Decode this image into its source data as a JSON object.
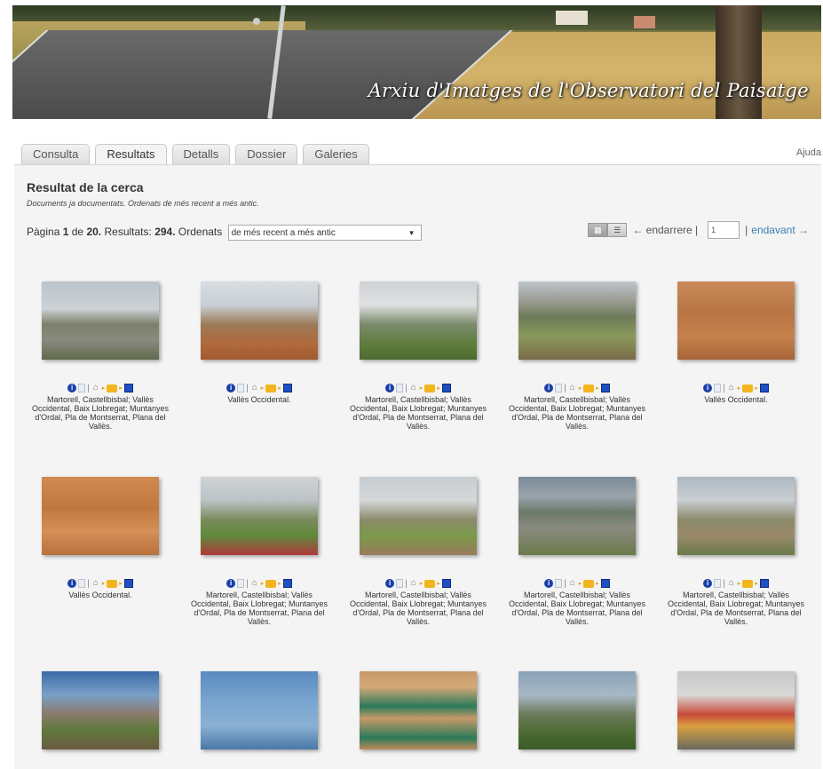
{
  "banner": {
    "title": "Arxiu d'Imatges de l'Observatori del Paisatge"
  },
  "tabs": [
    {
      "label": "Consulta",
      "active": false
    },
    {
      "label": "Resultats",
      "active": true
    },
    {
      "label": "Detalls",
      "active": false
    },
    {
      "label": "Dossier",
      "active": false
    },
    {
      "label": "Galeries",
      "active": false
    }
  ],
  "help_link": "Ajuda",
  "results": {
    "heading": "Resultat de la cerca",
    "subheading": "Documents ja documentats. Ordenats de més recent a més antic.",
    "page_label": "Pàgina",
    "page_current": "1",
    "page_of": "de",
    "page_total": "20.",
    "results_label": "Resultats:",
    "results_count": "294.",
    "sort_label": "Ordenats",
    "sort_value": "de més recent a més antic"
  },
  "pager": {
    "back_label": "← endarrere |",
    "page_value": "1",
    "separator": "|",
    "next_label": "endavant →"
  },
  "items": [
    {
      "caption": "Martorell, Castellbisbal; Vallès Occidental, Baix Llobregat; Muntanyes d'Ordal, Pla de Montserrat, Plana del Vallès."
    },
    {
      "caption": "Vallès Occidental."
    },
    {
      "caption": "Martorell, Castellbisbal; Vallès Occidental, Baix Llobregat; Muntanyes d'Ordal, Pla de Montserrat, Plana del Vallès."
    },
    {
      "caption": "Martorell, Castellbisbal; Vallès Occidental, Baix Llobregat; Muntanyes d'Ordal, Pla de Montserrat, Plana del Vallès."
    },
    {
      "caption": "Vallès Occidental."
    },
    {
      "caption": "Vallès Occidental."
    },
    {
      "caption": "Martorell, Castellbisbal; Vallès Occidental, Baix Llobregat; Muntanyes d'Ordal, Pla de Montserrat, Plana del Vallès."
    },
    {
      "caption": "Martorell, Castellbisbal; Vallès Occidental, Baix Llobregat; Muntanyes d'Ordal, Pla de Montserrat, Plana del Vallès."
    },
    {
      "caption": "Martorell, Castellbisbal; Vallès Occidental, Baix Llobregat; Muntanyes d'Ordal, Pla de Montserrat, Plana del Vallès."
    },
    {
      "caption": "Martorell, Castellbisbal; Vallès Occidental, Baix Llobregat; Muntanyes d'Ordal, Pla de Montserrat, Plana del Vallès."
    },
    {
      "caption": ""
    },
    {
      "caption": ""
    },
    {
      "caption": ""
    },
    {
      "caption": ""
    },
    {
      "caption": ""
    }
  ],
  "icons": {
    "info": "info-icon",
    "doc": "document-icon",
    "home": "home-icon",
    "folder": "add-to-dossier-folder-icon",
    "square": "select-icon"
  },
  "colors": {
    "link": "#3a7fb0",
    "info_icon": "#1a3fa8",
    "folder_icon": "#f2b51d"
  }
}
